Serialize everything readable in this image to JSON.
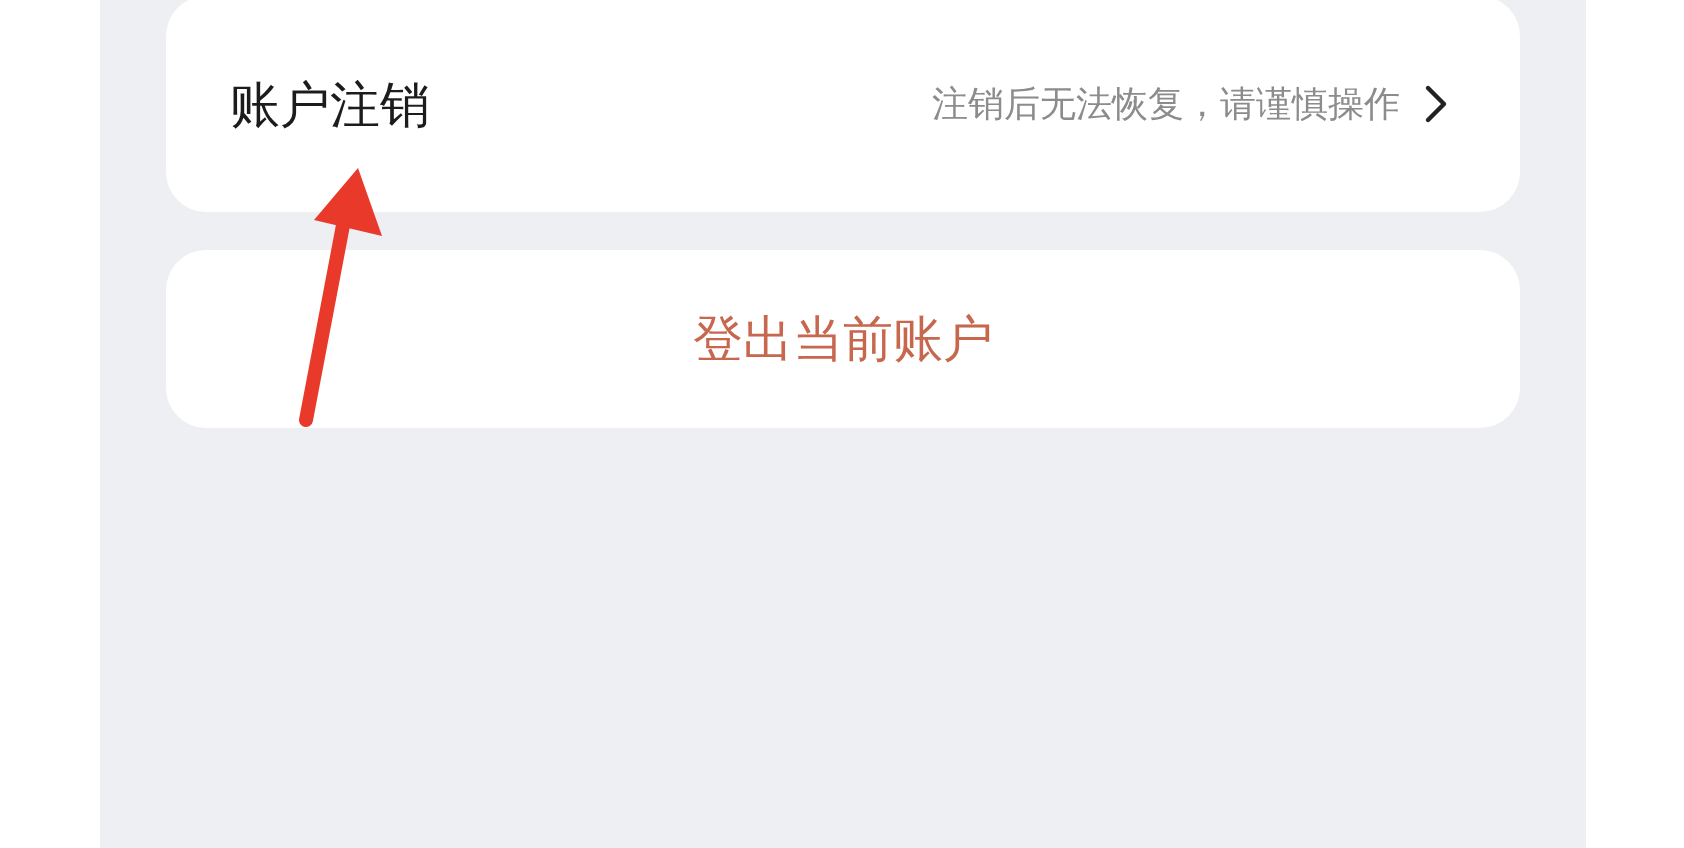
{
  "settings": [
    {
      "label": "账户注销",
      "hint": "注销后无法恢复，请谨慎操作"
    }
  ],
  "logout_button": {
    "label": "登出当前账户"
  }
}
